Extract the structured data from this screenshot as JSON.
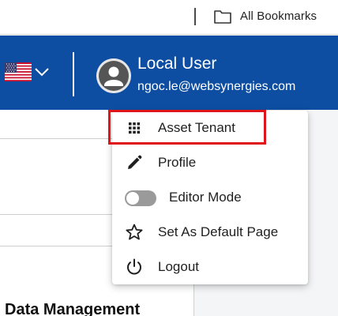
{
  "browser": {
    "bookmarks_bar": {
      "all_bookmarks_label": "All Bookmarks",
      "folder_icon": "folder-icon"
    }
  },
  "header": {
    "language_flag_icon": "us-flag-icon",
    "user": {
      "name": "Local User",
      "email": "ngoc.le@websynergies.com",
      "avatar_icon": "user-avatar-icon"
    },
    "colors": {
      "background": "#0d4ea2",
      "text": "#ffffff"
    }
  },
  "dropdown": {
    "items": [
      {
        "label": "Asset Tenant",
        "icon": "grid-icon",
        "highlighted": true
      },
      {
        "label": "Profile",
        "icon": "pencil-icon"
      },
      {
        "label": "Editor Mode",
        "icon": "toggle-icon",
        "toggle_on": false
      },
      {
        "label": "Set As Default Page",
        "icon": "star-outline-icon"
      },
      {
        "label": "Logout",
        "icon": "power-icon"
      }
    ],
    "highlight_color": "#e0151c"
  },
  "page": {
    "section_heading": "Data Management"
  }
}
